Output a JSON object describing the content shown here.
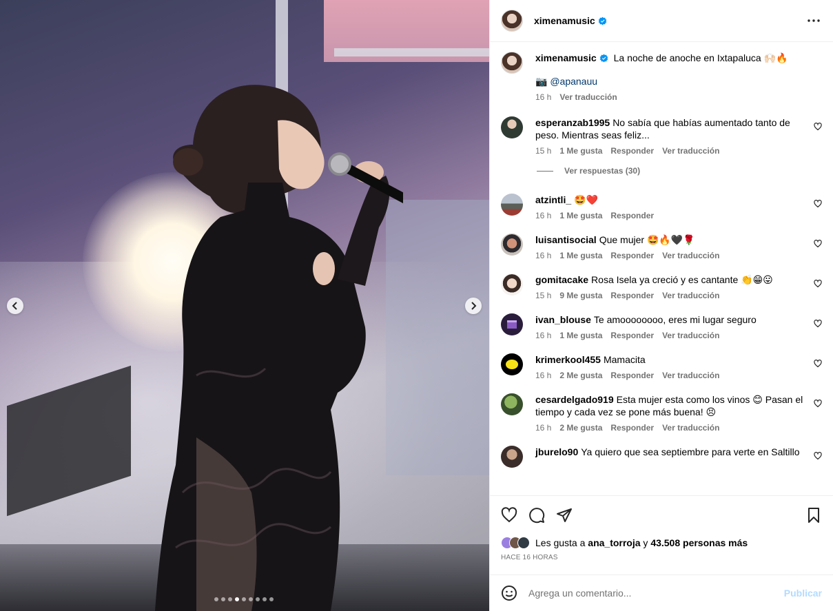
{
  "post": {
    "username": "ximenamusic",
    "verified": true,
    "caption_text": "La noche de anoche en Ixtapaluca 🙌🏻🔥",
    "caption_line2_icon": "📷",
    "caption_mention": "@apanauu",
    "caption_time": "16 h",
    "translate_label": "Ver traducción"
  },
  "media": {
    "carousel_total": 9,
    "carousel_active_index": 3,
    "prev_icon": "chevron-left-icon",
    "next_icon": "chevron-right-icon"
  },
  "comments": [
    {
      "username": "esperanzab1995",
      "text": "No sabía que habías aumentado tanto de peso. Mientras seas feliz...",
      "time": "15 h",
      "likes": "1 Me gusta",
      "reply": "Responder",
      "translate": "Ver traducción",
      "view_replies": "Ver respuestas (30)"
    },
    {
      "username": "atzintli_",
      "text": "🤩❤️",
      "time": "16 h",
      "likes": "1 Me gusta",
      "reply": "Responder"
    },
    {
      "username": "luisantisocial",
      "text": "Que mujer 🤩🔥🖤🌹",
      "time": "16 h",
      "likes": "1 Me gusta",
      "reply": "Responder",
      "translate": "Ver traducción"
    },
    {
      "username": "gomitacake",
      "text": "Rosa Isela ya creció y es cantante 👏😁😛",
      "time": "15 h",
      "likes": "9 Me gusta",
      "reply": "Responder",
      "translate": "Ver traducción"
    },
    {
      "username": "ivan_blouse",
      "text": "Te amoooooooo, eres mi lugar seguro",
      "time": "16 h",
      "likes": "1 Me gusta",
      "reply": "Responder",
      "translate": "Ver traducción"
    },
    {
      "username": "krimerkool455",
      "text": "Mamacita",
      "time": "16 h",
      "likes": "2 Me gusta",
      "reply": "Responder",
      "translate": "Ver traducción"
    },
    {
      "username": "cesardelgado919",
      "text": "Esta mujer esta como los vinos 😊 Pasan el tiempo y cada vez se pone más buena! 😣",
      "time": "16 h",
      "likes": "2 Me gusta",
      "reply": "Responder",
      "translate": "Ver traducción"
    },
    {
      "username": "jburelo90",
      "text": "Ya quiero que sea septiembre para verte en Saltillo"
    }
  ],
  "likes": {
    "prefix": "Les gusta a",
    "user": "ana_torroja",
    "connector": "y",
    "others": "43.508 personas más"
  },
  "time_ago": "HACE 16 HORAS",
  "add_comment": {
    "placeholder": "Agrega un comentario...",
    "post_label": "Publicar"
  },
  "colors": {
    "link": "#00376b",
    "secondary_text": "#737373",
    "verified": "#0095f6",
    "post_disabled": "#b3dbff"
  }
}
